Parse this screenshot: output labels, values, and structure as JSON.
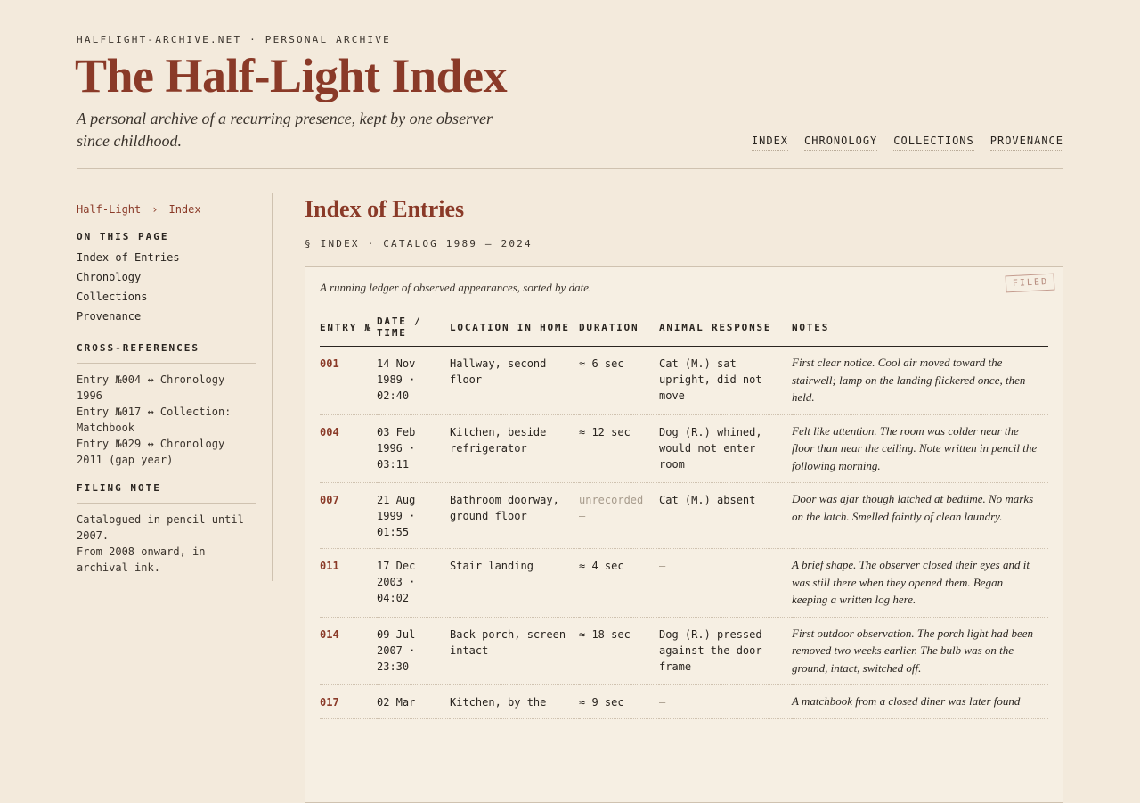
{
  "site": {
    "label": "HALFLIGHT-ARCHIVE.NET · PERSONAL ARCHIVE",
    "title": "The Half-Light Index",
    "tagline": "A personal archive of a recurring presence, kept by one observer since childhood."
  },
  "nav": [
    "INDEX",
    "CHRONOLOGY",
    "COLLECTIONS",
    "PROVENANCE"
  ],
  "breadcrumb": {
    "root": "Half-Light",
    "sep": "›",
    "current": "Index"
  },
  "sidebar": {
    "on_this_page_heading": "ON THIS PAGE",
    "on_this_page": [
      "Index of Entries",
      "Chronology",
      "Collections",
      "Provenance"
    ],
    "xref_heading": "CROSS-REFERENCES",
    "xrefs": [
      "Entry №004 ↔ Chronology 1996",
      "Entry №017 ↔ Collection: Matchbook",
      "Entry №029 ↔ Chronology 2011 (gap year)"
    ],
    "filing_heading": "FILING NOTE",
    "filing_lines": [
      "Catalogued in pencil until 2007.",
      "From 2008 onward, in archival ink."
    ]
  },
  "main": {
    "title": "Index of Entries",
    "eyebrow": "§ INDEX · CATALOG 1989 — 2024",
    "stamp": "FILED",
    "caption": "A running ledger of observed appearances, sorted by date.",
    "columns": [
      "ENTRY №",
      "DATE / TIME",
      "LOCATION IN HOME",
      "DURATION",
      "ANIMAL RESPONSE",
      "NOTES"
    ],
    "rows": [
      {
        "entry": "001",
        "datetime": "14 Nov 1989 · 02:40",
        "location": "Hallway, second floor",
        "duration": "≈ 6 sec",
        "animal": "Cat (M.) sat upright, did not move",
        "notes": "First clear notice. Cool air moved toward the stairwell; lamp on the landing flickered once, then held."
      },
      {
        "entry": "004",
        "datetime": "03 Feb 1996 · 03:11",
        "location": "Kitchen, beside refrigerator",
        "duration": "≈ 12 sec",
        "animal": "Dog (R.) whined, would not enter room",
        "notes": "Felt like attention. The room was colder near the floor than near the ceiling. Note written in pencil the following morning."
      },
      {
        "entry": "007",
        "datetime": "21 Aug 1999 · 01:55",
        "location": "Bathroom doorway, ground floor",
        "duration": "unrecorded —",
        "animal": "Cat (M.) absent",
        "notes": "Door was ajar though latched at bedtime. No marks on the latch. Smelled faintly of clean laundry."
      },
      {
        "entry": "011",
        "datetime": "17 Dec 2003 · 04:02",
        "location": "Stair landing",
        "duration": "≈ 4 sec",
        "animal": "—",
        "notes": "A brief shape. The observer closed their eyes and it was still there when they opened them. Began keeping a written log here."
      },
      {
        "entry": "014",
        "datetime": "09 Jul 2007 · 23:30",
        "location": "Back porch, screen intact",
        "duration": "≈ 18 sec",
        "animal": "Dog (R.) pressed against the door frame",
        "notes": "First outdoor observation. The porch light had been removed two weeks earlier. The bulb was on the ground, intact, switched off."
      },
      {
        "entry": "017",
        "datetime": "02 Mar",
        "location": "Kitchen, by the",
        "duration": "≈ 9 sec",
        "animal": "—",
        "notes": "A matchbook from a closed diner was later found"
      }
    ]
  }
}
